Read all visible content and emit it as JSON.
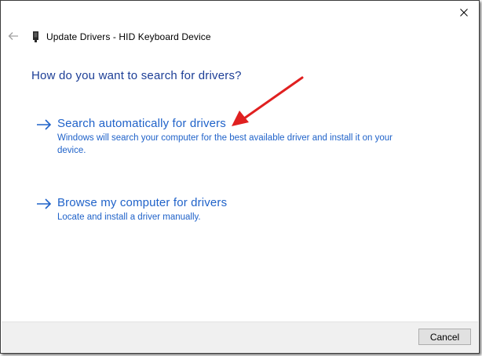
{
  "window": {
    "title": "Update Drivers - HID Keyboard Device"
  },
  "main": {
    "heading": "How do you want to search for drivers?",
    "options": [
      {
        "label": "Search automatically for drivers",
        "description": "Windows will search your computer for the best available driver and install it on your device."
      },
      {
        "label": "Browse my computer for drivers",
        "description": "Locate and install a driver manually."
      }
    ]
  },
  "footer": {
    "cancel_label": "Cancel"
  },
  "colors": {
    "heading": "#1c3e96",
    "link": "#1f62c9",
    "annotation_arrow": "#e02020",
    "footer_bg": "#f0f0f0"
  },
  "icons": [
    "close-icon",
    "back-arrow-icon",
    "device-icon",
    "right-arrow-icon"
  ]
}
